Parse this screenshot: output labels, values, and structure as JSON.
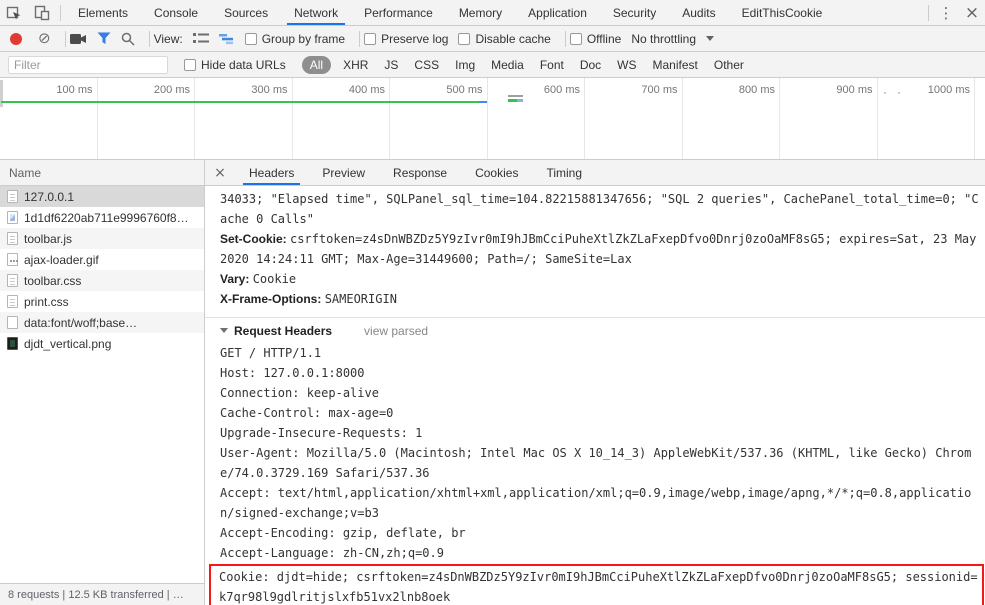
{
  "colors": {
    "accent_blue": "#1a73e8",
    "record_red": "#e03b33",
    "timeline_green": "#35c24d",
    "highlight_red": "#f51818",
    "selected_row_gray": "#d9d9d9",
    "all_pill_gray": "#8e8e8e"
  },
  "tabbar": {
    "tabs": [
      {
        "label": "Elements",
        "active": false
      },
      {
        "label": "Console",
        "active": false
      },
      {
        "label": "Sources",
        "active": false
      },
      {
        "label": "Network",
        "active": true
      },
      {
        "label": "Performance",
        "active": false
      },
      {
        "label": "Memory",
        "active": false
      },
      {
        "label": "Application",
        "active": false
      },
      {
        "label": "Security",
        "active": false
      },
      {
        "label": "Audits",
        "active": false
      },
      {
        "label": "EditThisCookie",
        "active": false
      }
    ],
    "more_glyph": "⋮",
    "close_glyph": "×"
  },
  "toolbar": {
    "view_label": "View:",
    "group_by_frame": "Group by frame",
    "preserve_log": "Preserve log",
    "disable_cache": "Disable cache",
    "offline": "Offline",
    "throttling": "No throttling",
    "clear_glyph": "⊘"
  },
  "filterbar": {
    "placeholder": "Filter",
    "hide_data_urls": "Hide data URLs",
    "types": [
      {
        "label": "All",
        "active": true
      },
      {
        "label": "XHR",
        "active": false
      },
      {
        "label": "JS",
        "active": false
      },
      {
        "label": "CSS",
        "active": false
      },
      {
        "label": "Img",
        "active": false
      },
      {
        "label": "Media",
        "active": false
      },
      {
        "label": "Font",
        "active": false
      },
      {
        "label": "Doc",
        "active": false
      },
      {
        "label": "WS",
        "active": false
      },
      {
        "label": "Manifest",
        "active": false
      },
      {
        "label": "Other",
        "active": false
      }
    ]
  },
  "timeline": {
    "ticks": [
      "100 ms",
      "200 ms",
      "300 ms",
      "400 ms",
      "500 ms",
      "600 ms",
      "700 ms",
      "800 ms",
      "900 ms",
      "1000 ms"
    ]
  },
  "requests": {
    "name_header": "Name",
    "rows": [
      {
        "name": "127.0.0.1",
        "icon": "document",
        "selected": true
      },
      {
        "name": "1d1df6220ab711e9996760f8…",
        "icon": "image",
        "selected": false
      },
      {
        "name": "toolbar.js",
        "icon": "document",
        "selected": false
      },
      {
        "name": "ajax-loader.gif",
        "icon": "gif",
        "selected": false
      },
      {
        "name": "toolbar.css",
        "icon": "document",
        "selected": false
      },
      {
        "name": "print.css",
        "icon": "document",
        "selected": false
      },
      {
        "name": "data:font/woff;base…",
        "icon": "blank",
        "selected": false
      },
      {
        "name": "djdt_vertical.png",
        "icon": "image-dark",
        "selected": false
      }
    ]
  },
  "detail": {
    "close_glyph": "×",
    "tabs": [
      {
        "label": "Headers",
        "active": true
      },
      {
        "label": "Preview",
        "active": false
      },
      {
        "label": "Response",
        "active": false
      },
      {
        "label": "Cookies",
        "active": false
      },
      {
        "label": "Timing",
        "active": false
      }
    ],
    "response_overflow": "34033; \"Elapsed time\", SQLPanel_sql_time=104.82215881347656; \"SQL 2 queries\", CachePanel_total_time=0; \"Cache 0 Calls\"",
    "response_headers": [
      {
        "name": "Set-Cookie:",
        "value": "csrftoken=z4sDnWBZDz5Y9zIvr0mI9hJBmCciPuheXtlZkZLaFxepDfvo0Dnrj0zoOaMF8sG5; expires=Sat, 23 May 2020 14:24:11 GMT; Max-Age=31449600; Path=/; SameSite=Lax"
      },
      {
        "name": "Vary:",
        "value": "Cookie"
      },
      {
        "name": "X-Frame-Options:",
        "value": "SAMEORIGIN"
      }
    ],
    "request_headers_title": "Request Headers",
    "view_parsed": "view parsed",
    "request_lines": [
      "GET / HTTP/1.1",
      "Host: 127.0.0.1:8000",
      "Connection: keep-alive",
      "Cache-Control: max-age=0",
      "Upgrade-Insecure-Requests: 1",
      "User-Agent: Mozilla/5.0 (Macintosh; Intel Mac OS X 10_14_3) AppleWebKit/537.36 (KHTML, like Gecko) Chrome/74.0.3729.169 Safari/537.36",
      "Accept: text/html,application/xhtml+xml,application/xml;q=0.9,image/webp,image/apng,*/*;q=0.8,application/signed-exchange;v=b3",
      "Accept-Encoding: gzip, deflate, br",
      "Accept-Language: zh-CN,zh;q=0.9"
    ],
    "cookie_line": "Cookie: djdt=hide; csrftoken=z4sDnWBZDz5Y9zIvr0mI9hJBmCciPuheXtlZkZLaFxepDfvo0Dnrj0zoOaMF8sG5; sessionid=k7qr98l9gdlritjslxfb51vx2lnb8oek"
  },
  "status_bar": {
    "text": "8 requests | 12.5 KB transferred | …"
  }
}
